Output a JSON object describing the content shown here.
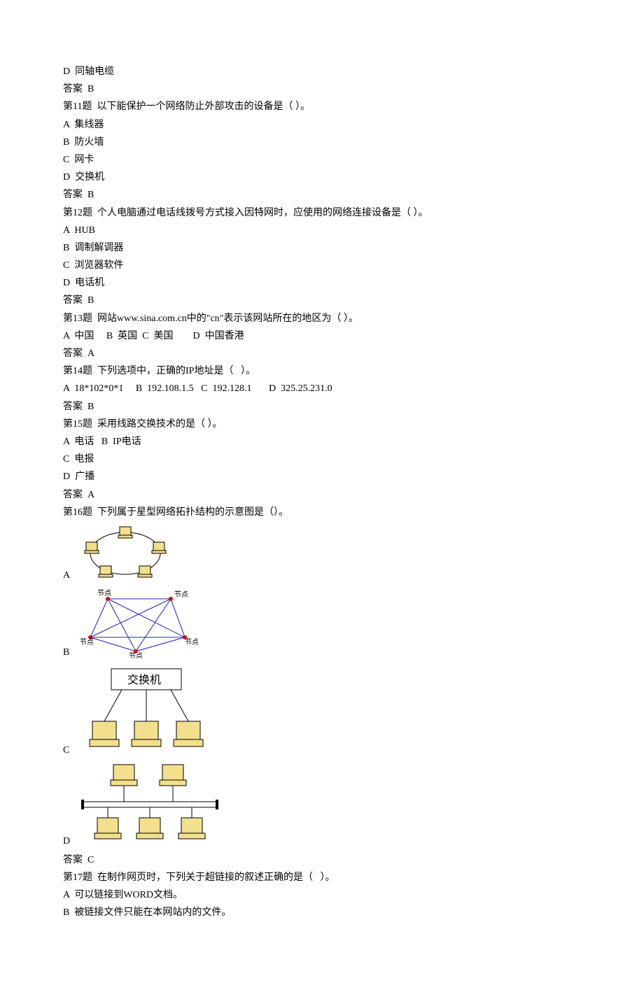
{
  "topLines": [
    "D  同轴电缆",
    "答案  B"
  ],
  "q11": {
    "title": "第11题  以下能保护一个网络防止外部攻击的设备是（ ）。",
    "opts": [
      "A  集线器",
      "B  防火墙",
      "C  网卡",
      "D  交换机"
    ],
    "ans": "答案  B"
  },
  "q12": {
    "title": "第12题  个人电脑通过电话线拨号方式接入因特网时，应使用的网络连接设备是（ ）。",
    "opts": [
      "A  HUB",
      "B  调制解调器",
      "C  浏览器软件",
      "D  电话机"
    ],
    "ans": "答案  B"
  },
  "q13": {
    "title": "第13题  网站www.sina.com.cn中的\"cn\"表示该网站所在的地区为（ ）。",
    "opts": "A  中国     B  英国  C  美国        D  中国香港",
    "ans": "答案  A"
  },
  "q14": {
    "title": "第14题  下列选项中，正确的IP地址是（   ）。",
    "opts": "A  18*102*0*1     B  192.108.1.5   C  192.128.1       D  325.25.231.0",
    "ans": "答案  B"
  },
  "q15": {
    "title": "第15题  采用线路交换技术的是（ ）。",
    "opts": [
      "A  电话   B  IP电话",
      "C  电报",
      "D  广播"
    ],
    "ans": "答案  A"
  },
  "q16": {
    "title": "第16题  下列属于星型网络拓扑结构的示意图是（）。",
    "labels": {
      "a": "A",
      "b": "B",
      "c": "C",
      "d": "D"
    },
    "switchLabel": "交换机",
    "nodeLabel": "节点",
    "ans": "答案  C"
  },
  "q17": {
    "title": "第17题  在制作网页时，下列关于超链接的叙述正确的是（   ）。",
    "opts": [
      "A  可以链接到WORD文档。",
      "B  被链接文件只能在本网站内的文件。"
    ]
  }
}
